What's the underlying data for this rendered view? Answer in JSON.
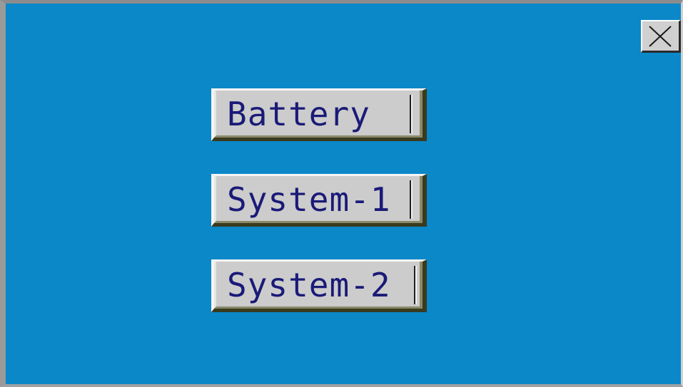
{
  "menu": {
    "items": [
      {
        "label": "Battery"
      },
      {
        "label": "System-1"
      },
      {
        "label": "System-2"
      }
    ]
  },
  "close": {
    "icon": "close-icon"
  },
  "colors": {
    "background": "#0a88c8",
    "button_face": "#cccccc",
    "button_text": "#1a1a78"
  }
}
